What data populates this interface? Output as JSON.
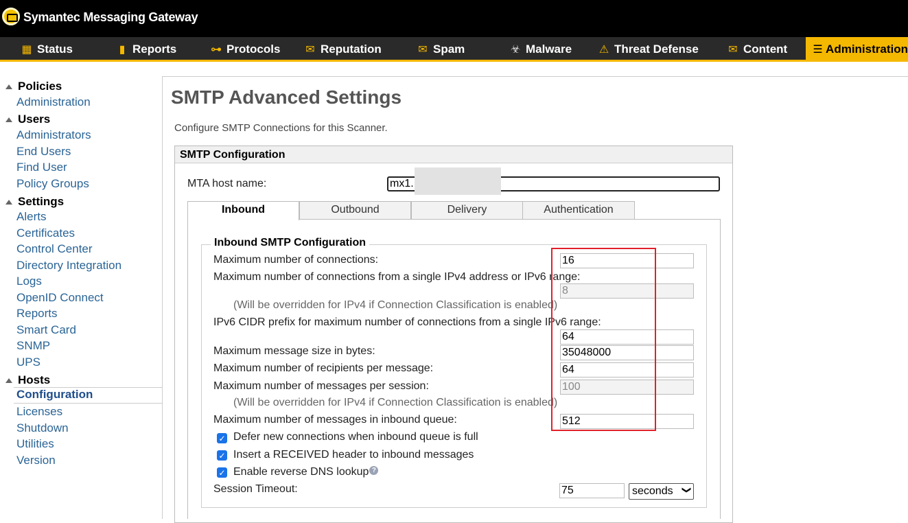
{
  "app": {
    "title": "Symantec Messaging Gateway"
  },
  "nav": [
    {
      "label": "Status",
      "icon": "status-icon"
    },
    {
      "label": "Reports",
      "icon": "reports-icon"
    },
    {
      "label": "Protocols",
      "icon": "protocols-icon"
    },
    {
      "label": "Reputation",
      "icon": "reputation-icon"
    },
    {
      "label": "Spam",
      "icon": "spam-icon"
    },
    {
      "label": "Malware",
      "icon": "malware-icon"
    },
    {
      "label": "Threat Defense",
      "icon": "threat-defense-icon"
    },
    {
      "label": "Content",
      "icon": "content-icon"
    },
    {
      "label": "Administration",
      "icon": "administration-icon",
      "active": true
    }
  ],
  "sidebar": {
    "groups": [
      {
        "label": "Policies",
        "items": [
          "Administration"
        ]
      },
      {
        "label": "Users",
        "items": [
          "Administrators",
          "End Users",
          "Find User",
          "Policy Groups"
        ]
      },
      {
        "label": "Settings",
        "items": [
          "Alerts",
          "Certificates",
          "Control Center",
          "Directory Integration",
          "Logs",
          "OpenID Connect",
          "Reports",
          "Smart Card",
          "SNMP",
          "UPS"
        ]
      },
      {
        "label": "Hosts",
        "items": [
          "Configuration",
          "Licenses",
          "Shutdown",
          "Utilities",
          "Version"
        ]
      }
    ],
    "selected": "Configuration"
  },
  "page": {
    "title": "SMTP Advanced Settings",
    "description": "Configure SMTP Connections for this Scanner."
  },
  "panel": {
    "title": "SMTP Configuration",
    "mta_label": "MTA host name:",
    "mta_value": "mx1."
  },
  "tabs": [
    "Inbound",
    "Outbound",
    "Delivery",
    "Authentication"
  ],
  "inbound": {
    "legend": "Inbound SMTP Configuration",
    "max_connections_label": "Maximum number of connections:",
    "max_connections": "16",
    "max_per_ip_label": "Maximum number of connections from a single IPv4 address or IPv6 range:",
    "max_per_ip": "8",
    "override_note": "(Will be overridden for IPv4 if Connection Classification is enabled)",
    "ipv6_prefix_label": "IPv6 CIDR prefix for maximum number of connections from a single IPv6 range:",
    "ipv6_prefix": "64",
    "max_msg_size_label": "Maximum message size in bytes:",
    "max_msg_size": "35048000",
    "max_recipients_label": "Maximum number of recipients per message:",
    "max_recipients": "64",
    "max_msgs_session_label": "Maximum number of messages per session:",
    "max_msgs_session": "100",
    "override_note2": "(Will be overridden for IPv4 if Connection Classification is enabled)",
    "max_queue_label": "Maximum number of messages in inbound queue:",
    "max_queue": "512",
    "defer_label": "Defer new connections when inbound queue is full",
    "received_label": "Insert a RECEIVED header to inbound messages",
    "rdns_label": "Enable reverse DNS lookup",
    "session_timeout_label": "Session Timeout:",
    "session_timeout": "75",
    "timeout_unit": "seconds"
  }
}
